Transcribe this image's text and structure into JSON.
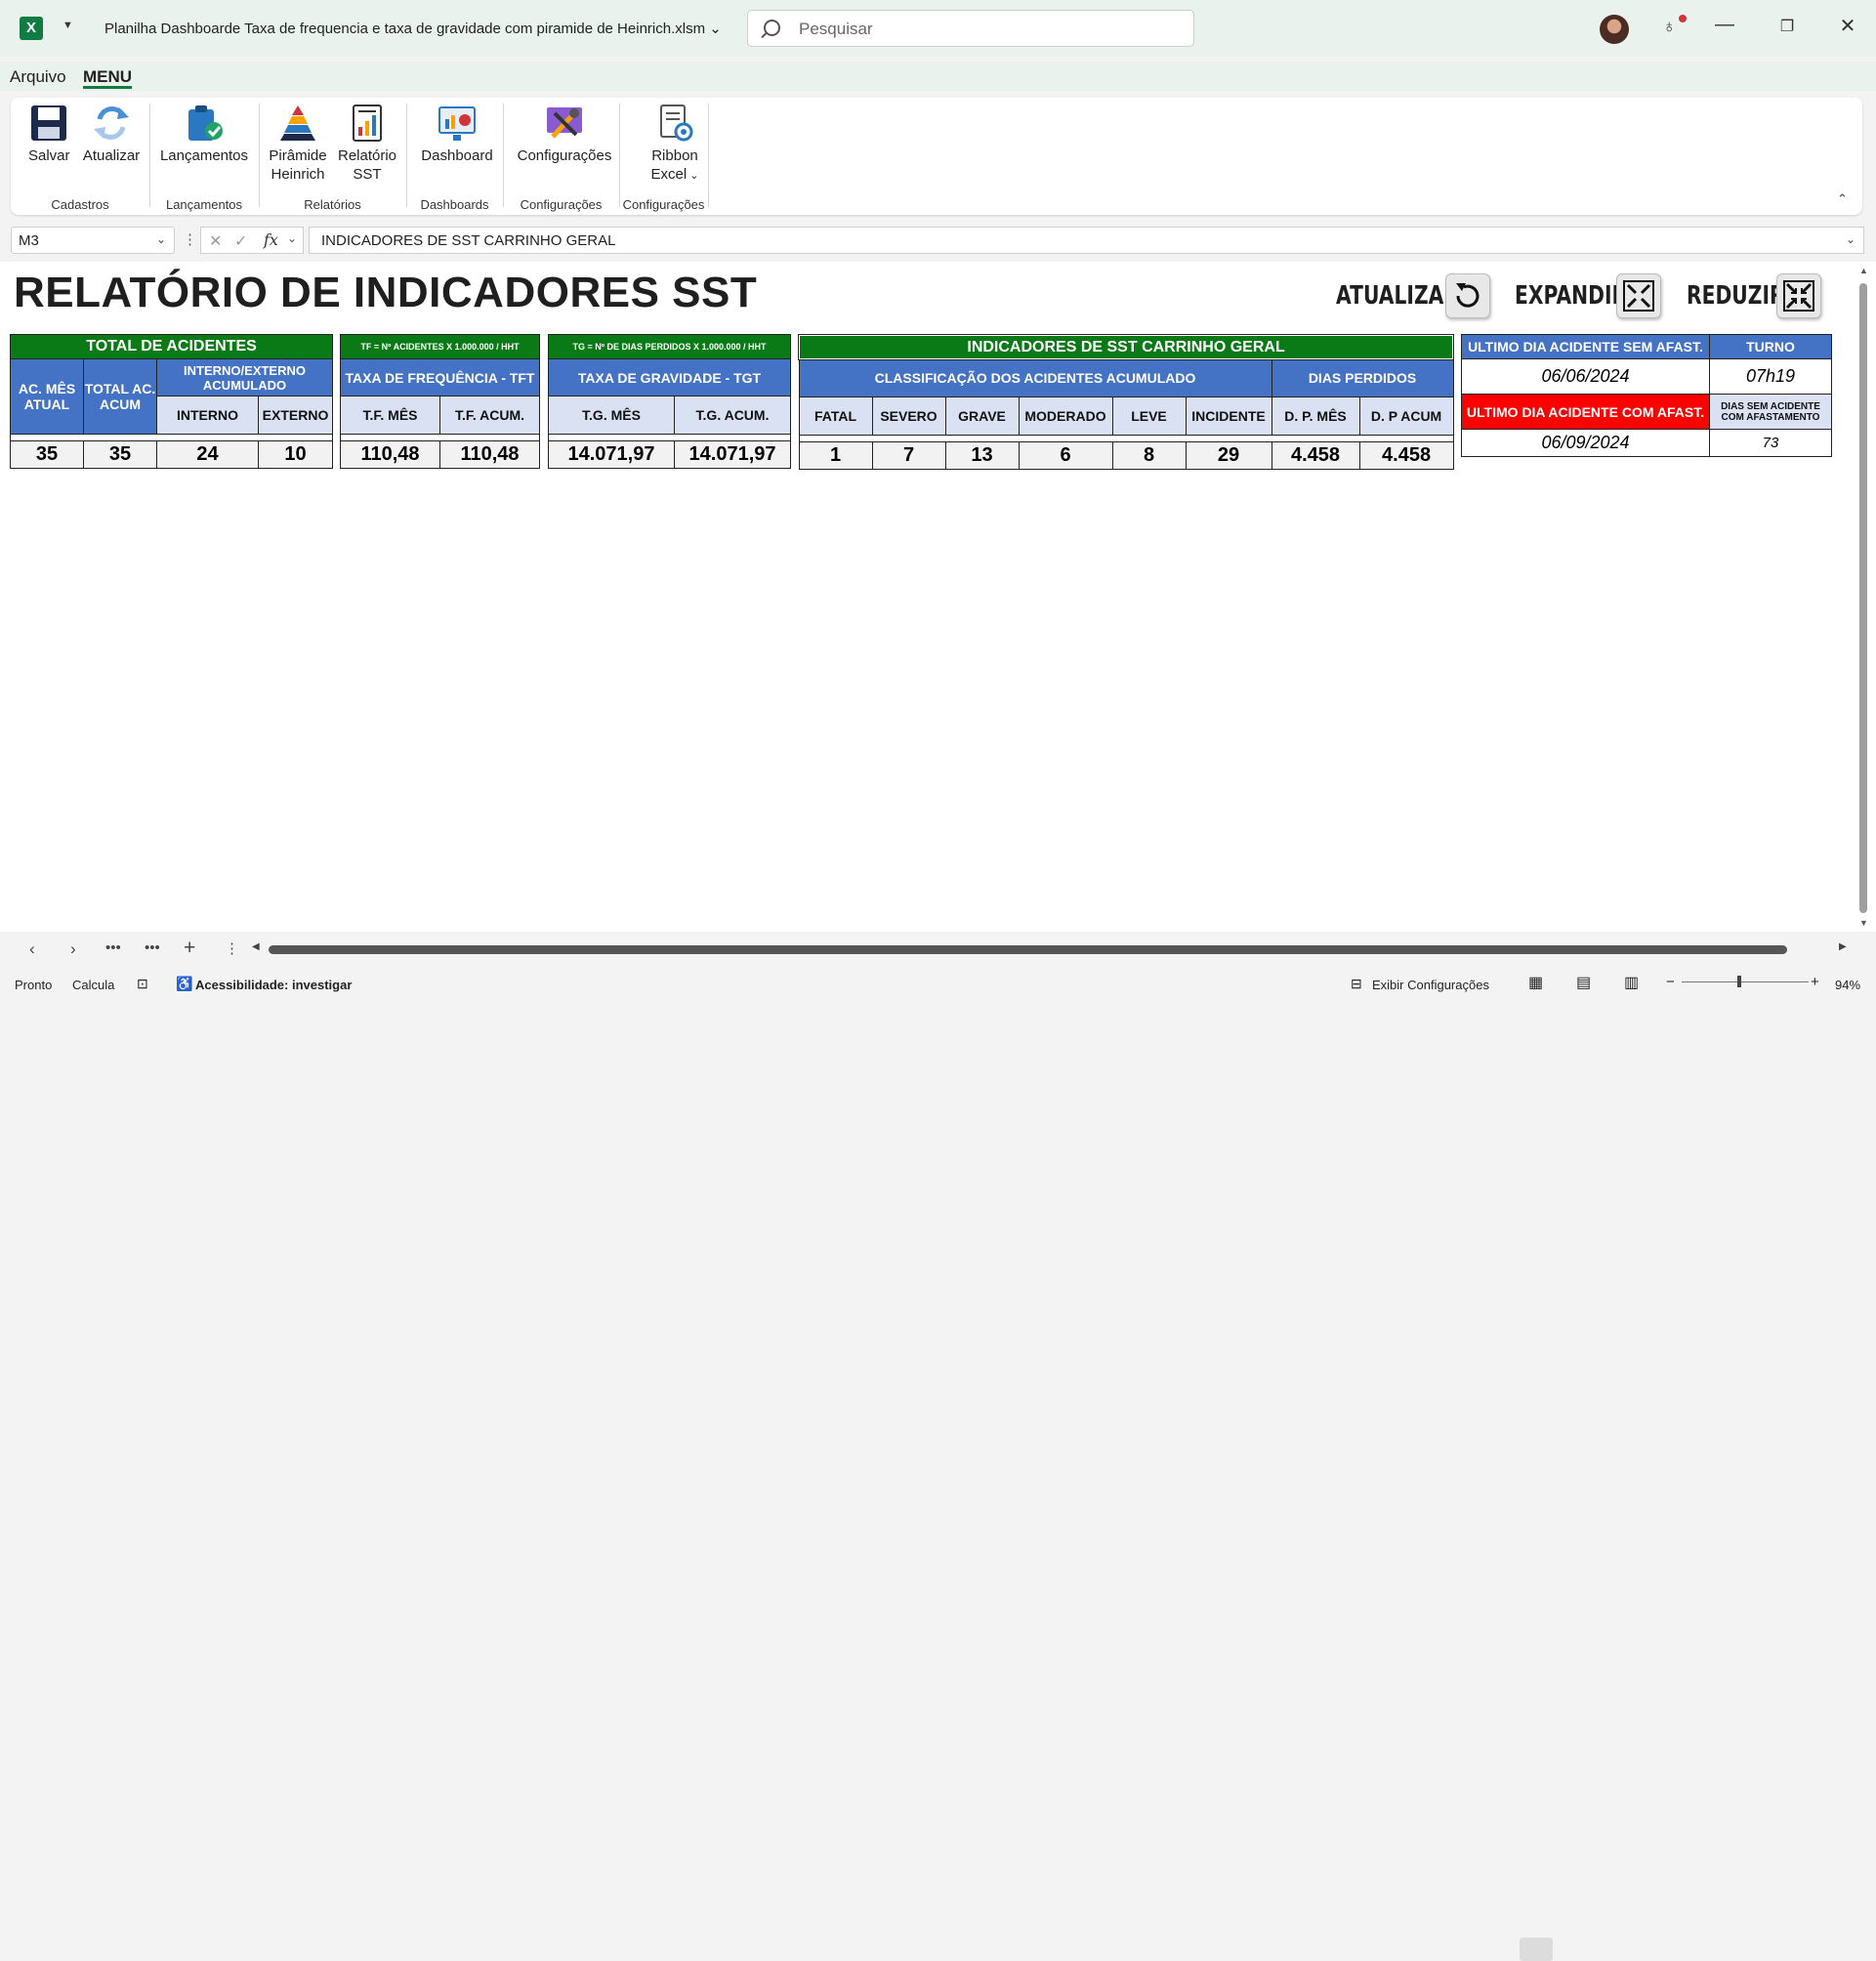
{
  "app": {
    "doc_title": "Planilha Dashboarde Taxa de frequencia e taxa de gravidade com piramide de Heinrich.xlsm",
    "search_placeholder": "Pesquisar",
    "colors": {
      "excel_green": "#107c41",
      "header_green": "#0a7a17",
      "header_blue": "#4472c4",
      "alert_red": "#ff0000"
    }
  },
  "tabs": {
    "arquivo": "Arquivo",
    "menu": "MENU"
  },
  "ribbon": {
    "salvar": "Salvar",
    "atualizar": "Atualizar",
    "lancamentos": "Lançamentos",
    "piramide_1": "Pirâmide",
    "piramide_2": "Heinrich",
    "relatorio_1": "Relatório",
    "relatorio_2": "SST",
    "dashboard": "Dashboard",
    "configuracoes": "Configurações",
    "ribbon_1": "Ribbon",
    "ribbon_2": "Excel",
    "groups": {
      "cadastros": "Cadastros",
      "lancamentos": "Lançamentos",
      "relatorios": "Relatórios",
      "dashboards": "Dashboards",
      "configuracoes1": "Configurações",
      "configuracoes2": "Configurações"
    }
  },
  "formula_bar": {
    "cell_ref": "M3",
    "content": "INDICADORES DE SST CARRINHO GERAL"
  },
  "sheet": {
    "title": "RELATÓRIO DE INDICADORES SST",
    "btn_atualizar": "ATUALIZAR",
    "btn_expandir": "EXPANDIR",
    "btn_reduzir": "REDUZIR",
    "total": {
      "header": "TOTAL DE ACIDENTES",
      "ac_mes": "AC. MÊS ATUAL",
      "total_acum": "TOTAL AC. ACUM",
      "int_ext": "INTERNO/EXTERNO ACUMULADO",
      "interno": "INTERNO",
      "externo": "EXTERNO",
      "v_mes": "35",
      "v_acum": "35",
      "v_interno": "24",
      "v_externo": "10"
    },
    "tf": {
      "formula": "TF = Nº ACIDENTES X 1.000.000 / HHT",
      "header": "TAXA DE FREQUÊNCIA - TFT",
      "mes": "T.F. MÊS",
      "acum": "T.F. ACUM.",
      "v_mes": "110,48",
      "v_acum": "110,48"
    },
    "tg": {
      "formula": "TG = Nº DE DIAS PERDIDOS X 1.000.000 / HHT",
      "header": "TAXA DE GRAVIDADE - TGT",
      "mes": "T.G. MÊS",
      "acum": "T.G. ACUM.",
      "v_mes": "14.071,97",
      "v_acum": "14.071,97"
    },
    "ind": {
      "header": "INDICADORES DE SST CARRINHO GERAL",
      "classificacao": "CLASSIFICAÇÃO DOS ACIDENTES ACUMULADO",
      "dias_perdidos": "DIAS PERDIDOS",
      "cols": [
        "FATAL",
        "SEVERO",
        "GRAVE",
        "MODERADO",
        "LEVE",
        "INCIDENTE",
        "D. P. MÊS",
        "D. P ACUM"
      ],
      "vals": [
        "1",
        "7",
        "13",
        "6",
        "8",
        "29",
        "4.458",
        "4.458"
      ]
    },
    "ultimo": {
      "sem_afast": "ULTIMO DIA ACIDENTE SEM AFAST.",
      "turno": "TURNO",
      "data_sem": "06/06/2024",
      "turno_val": "07h19",
      "com_afast": "ULTIMO DIA ACIDENTE COM AFAST.",
      "dias_sem": "DIAS SEM ACIDENTE COM AFASTAMENTO",
      "data_com": "06/09/2024",
      "dias_val": "73"
    }
  },
  "status": {
    "pronto": "Pronto",
    "calcula": "Calcula",
    "acessibilidade": "Acessibilidade: investigar",
    "exibir": "Exibir Configurações",
    "zoom": "94%"
  }
}
